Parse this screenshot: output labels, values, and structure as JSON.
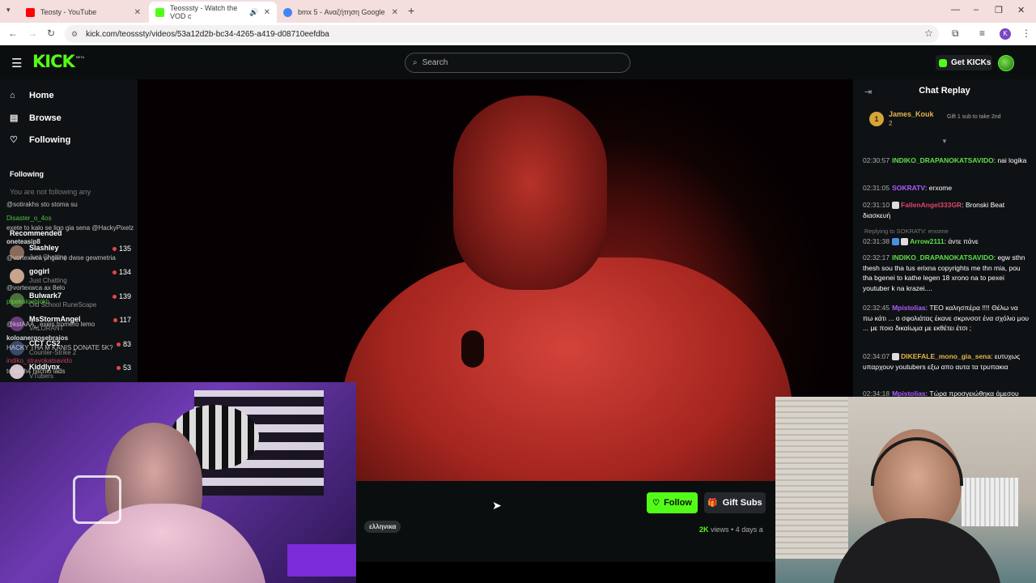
{
  "browser": {
    "tabs": [
      {
        "title": "Teosty - YouTube",
        "favicon_color": "#ff0000"
      },
      {
        "title": "Teosssty - Watch the VOD c",
        "favicon_color": "#53fc18"
      },
      {
        "title": "bmx 5 - Αναζήτηση Google",
        "favicon_color": "#4285f4"
      }
    ],
    "url": "kick.com/teosssty/videos/53a12d2b-bc34-4265-a419-d08710eefdba",
    "profile_initial": "K"
  },
  "header": {
    "logo": "KICK",
    "beta": "BETA",
    "search_placeholder": "Search",
    "get_kicks": "Get KICKs"
  },
  "sidebar": {
    "nav": [
      {
        "label": "Home",
        "icon": "home-icon"
      },
      {
        "label": "Browse",
        "icon": "browse-icon"
      },
      {
        "label": "Following",
        "icon": "heart-icon"
      }
    ],
    "following_heading": "Following",
    "following_empty": "You are not following any",
    "recommended_heading": "Recommended",
    "recommended": [
      {
        "name": "Slashley",
        "category": "Just Chatting",
        "viewers": "135"
      },
      {
        "name": "gogirl",
        "category": "Just Chatting",
        "viewers": "134"
      },
      {
        "name": "Bulwark7",
        "category": "Old School RuneScape",
        "viewers": "139"
      },
      {
        "name": "MsStormAngel",
        "category": "VALORANT",
        "viewers": "117"
      },
      {
        "name": "CCT CS2",
        "category": "Counter-Strike 2",
        "viewers": "83"
      },
      {
        "name": "Kiddlynx",
        "category": "VTubers",
        "viewers": "53"
      }
    ],
    "overlay_chat": [
      {
        "user": "Disaster_o_4os",
        "text": ""
      },
      {
        "user": "",
        "text": "@sotirakhs sto stoma su"
      },
      {
        "user": "",
        "text": "exete to kalo se ligo gia sena @HackyPixelz"
      },
      {
        "user": "oneteasip8",
        "text": ""
      },
      {
        "user": "",
        "text": "@vortexwca phgaine dwse gewmetria"
      },
      {
        "user": "",
        "text": "@vortexwca ax 8elo"
      },
      {
        "user": "pipekoioebloklı",
        "text": ""
      },
      {
        "user": "",
        "text": "@kstAAA_ exeis tromero lemo"
      },
      {
        "user": "koloanergosebraios",
        "text": ""
      },
      {
        "user": "",
        "text": "HACKY THA M KANIS DONATE 5K?"
      },
      {
        "user": "indiko_stravokatsavido",
        "text": ""
      },
      {
        "user": "",
        "text": "to esch4 hitchio lads"
      }
    ]
  },
  "player": {
    "follow_label": "Follow",
    "gift_subs_label": "Gift Subs",
    "language_tag": "ελληνικα",
    "views_count": "2K",
    "views_label": "views",
    "age": "4 days a"
  },
  "chat": {
    "title": "Chat Replay",
    "pinned": {
      "rank": "1",
      "name": "James_Kouk",
      "count": "2",
      "gift_text": "Gift 1 sub to take 2nd"
    },
    "messages": [
      {
        "time": "02:30:57",
        "user": "INDIKO_DRAPANOKATSAVIDO",
        "color": "#5ddf47",
        "text": "nai logika"
      },
      {
        "time": "02:31:05",
        "user": "SOKRATV",
        "color": "#b05cff",
        "text": "erxome"
      },
      {
        "time": "02:31:10",
        "user": "FallenAngel333GR",
        "color": "#e0466a",
        "text": "Bronski Beat διασκευή"
      },
      {
        "time": "02:31:38",
        "user": "Arrow2111",
        "color": "#5ddf47",
        "text": "άντε πάνε"
      },
      {
        "time": "02:32:17",
        "user": "INDIKO_DRAPANOKATSAVIDO",
        "color": "#5ddf47",
        "text": "egw sthn thesh sou tha tus erixna copyrights me thn mia, pou tha bgenei to kathe legen 18 xrono na to pexei youtuber k na krazei...."
      },
      {
        "time": "02:32:45",
        "user": "Mpistolias",
        "color": "#b05cff",
        "text": "ΤΕΟ καλησπέρα !!!! Θέλω να πω κάτι ... ο σφολιάτας έκανε σκρινσοτ ένα σχόλιο μου ... με ποιο δικαίωμα με εκθέτει έτσι ;"
      },
      {
        "time": "02:34:07",
        "user": "DIKEFALE_mono_gia_sena",
        "color": "#e3b34b",
        "text": "ευτυχως υπαρχουν youtubers εξω απο αυτα τα τρυπακια"
      },
      {
        "time": "02:34:18",
        "user": "Mpistolias",
        "color": "#b05cff",
        "text": "Τώρα προσγειώθηκα άμεσου"
      }
    ],
    "reply_note": "Replying to SOKRATV: erxome"
  }
}
